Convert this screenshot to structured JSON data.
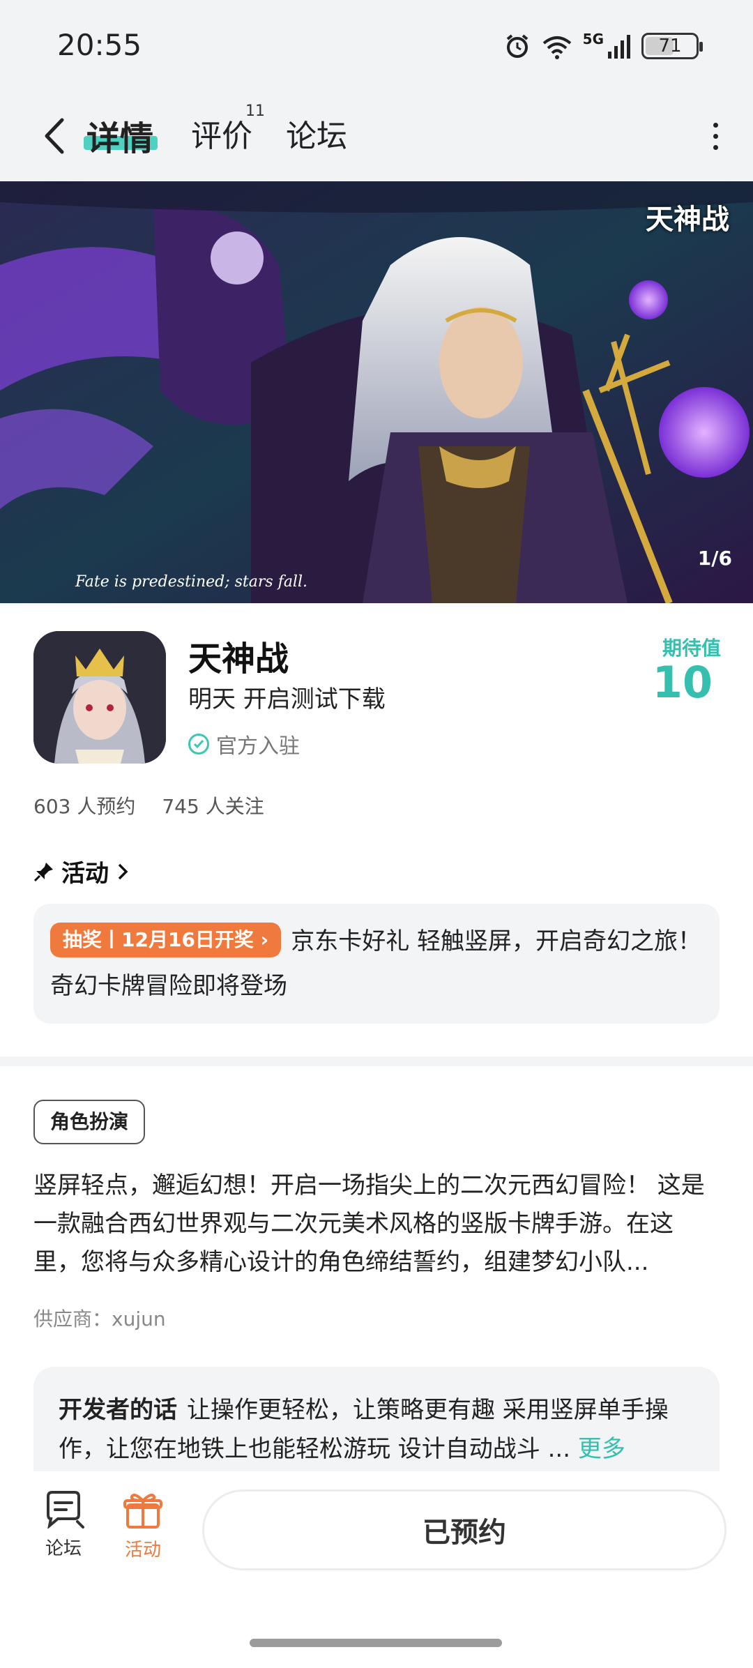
{
  "status_bar": {
    "time": "20:55",
    "battery": "71",
    "network": "5G",
    "icons": [
      "alarm-icon",
      "wifi-icon",
      "signal-icon",
      "battery-icon"
    ]
  },
  "nav": {
    "tabs": [
      {
        "label": "详情",
        "active": true
      },
      {
        "label": "评价",
        "badge": "11"
      },
      {
        "label": "论坛"
      }
    ]
  },
  "banner": {
    "counter": "1/6",
    "logo_text": "天神战",
    "caption": "Fate is predestined; stars fall."
  },
  "game": {
    "title": "天神战",
    "subtitle": "明天 开启测试下载",
    "official": "官方入驻",
    "expect_label": "期待值",
    "expect_value": "10",
    "reservations": "603 人预约",
    "followers": "745 人关注"
  },
  "activity": {
    "heading": "活动",
    "tag": "抽奖丨12月16日开奖",
    "text": "京东卡好礼 轻触竖屏，开启奇幻之旅！奇幻卡牌冒险即将登场"
  },
  "details": {
    "genre": "角色扮演",
    "description": "竖屏轻点，邂逅幻想！开启一场指尖上的二次元西幻冒险！ 这是一款融合西幻世界观与二次元美术风格的竖版卡牌手游。在这里，您将与众多精心设计的角色缔结誓约，组建梦幻小队...",
    "supplier": "供应商：xujun"
  },
  "developer": {
    "label": "开发者的话",
    "text": "让操作更轻松，让策略更有趣 采用竖屏单手操作，让您在地铁上也能轻松游玩 设计自动战斗 ...",
    "more": "更多"
  },
  "bottom_bar": {
    "forum_label": "论坛",
    "activity_label": "活动",
    "reserve_label": "已预约"
  },
  "colors": {
    "accent": "#35bfae",
    "orange": "#f07a3e",
    "background_gray": "#f2f3f5"
  }
}
